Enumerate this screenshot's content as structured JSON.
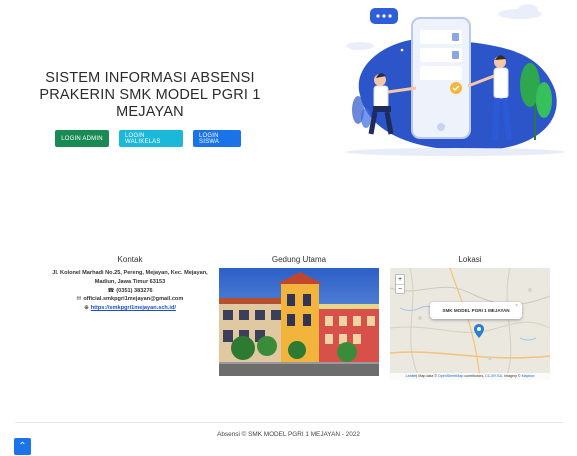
{
  "hero": {
    "title": "SISTEM INFORMASI ABSENSI PRAKERIN SMK MODEL PGRI 1 MEJAYAN",
    "buttons": {
      "admin": "LOGIN ADMIN",
      "walikelas": "LOGIN WALIKELAS",
      "siswa": "LOGIN SISWA"
    }
  },
  "contact": {
    "title": "Kontak",
    "address": "Jl. Kolonel Marhadi No.25, Pereng, Mejayan, Kec. Mejayan, Madiun, Jawa Timur 63153",
    "phone": "(0351) 383276",
    "email": "official.smkpgri1mejayan@gmail.com",
    "website": "https://smkpgri1mejayan.sch.id/"
  },
  "gedung": {
    "title": "Gedung Utama"
  },
  "lokasi": {
    "title": "Lokasi",
    "popup": "SMK MODEL PGRI 1 MEJAYAN",
    "zoom_in": "+",
    "zoom_out": "−",
    "attribution_leaflet": "Leaflet",
    "attribution_map": "| Map data © ",
    "attribution_osm": "OpenStreetMap",
    "attribution_contrib": " contributors, ",
    "attribution_cc": "CC-BY-SA",
    "attribution_imagery": ", Imagery © ",
    "attribution_mapbox": "Mapbox"
  },
  "footer": {
    "copyright": "Absensi © SMK MODEL PGRI 1 MEJAYAN - 2022"
  },
  "colors": {
    "admin": "#1a8a55",
    "walikelas": "#1bb8d9",
    "siswa": "#1a73e8"
  }
}
